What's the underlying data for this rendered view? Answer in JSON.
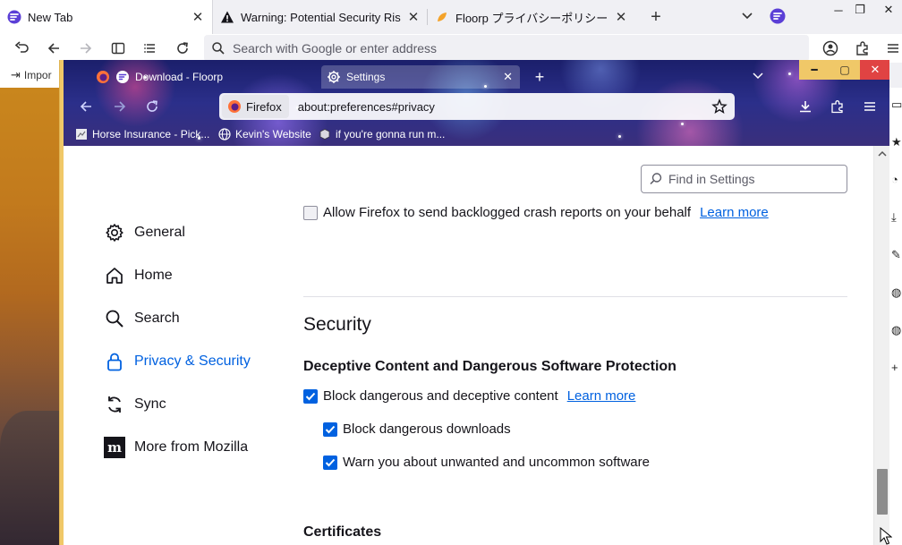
{
  "outer": {
    "tabs": [
      {
        "label": "New Tab",
        "icon": "floorp-icon"
      },
      {
        "label": "Warning: Potential Security Risk Ah",
        "icon": "warning-icon"
      },
      {
        "label": "Floorp プライバシーポリシー / Ab",
        "icon": "floorp-privacy-icon"
      }
    ],
    "url_placeholder": "Search with Google or enter address",
    "bookmark": "Impor"
  },
  "inner": {
    "tabs": [
      {
        "label": "Download - Floorp",
        "icon": "floorp-icon"
      },
      {
        "label": "Settings",
        "icon": "gear-icon"
      }
    ],
    "identity_label": "Firefox",
    "address": "about:preferences#privacy",
    "bookmarks": [
      {
        "label": "Horse Insurance - Pick...",
        "icon": "page-icon"
      },
      {
        "label": "Kevin's Website",
        "icon": "globe-icon"
      },
      {
        "label": "if you're gonna run m...",
        "icon": "page-icon"
      }
    ]
  },
  "settings": {
    "find_placeholder": "Find in Settings",
    "categories": [
      {
        "label": "General",
        "icon": "gear-icon"
      },
      {
        "label": "Home",
        "icon": "home-icon"
      },
      {
        "label": "Search",
        "icon": "search-icon"
      },
      {
        "label": "Privacy & Security",
        "icon": "lock-icon",
        "selected": true
      },
      {
        "label": "Sync",
        "icon": "sync-icon"
      },
      {
        "label": "More from Mozilla",
        "icon": "mozilla-icon"
      }
    ],
    "crash_reports": {
      "label": "Allow Firefox to send backlogged crash reports on your behalf",
      "link": "Learn more",
      "checked": false
    },
    "security_heading": "Security",
    "deceptive_heading": "Deceptive Content and Dangerous Software Protection",
    "block_deceptive": {
      "label": "Block dangerous and deceptive content",
      "link": "Learn more",
      "checked": true
    },
    "block_downloads": {
      "label": "Block dangerous downloads",
      "checked": true
    },
    "warn_unwanted": {
      "label": "Warn you about unwanted and uncommon software",
      "checked": true
    },
    "certificates_heading": "Certificates"
  },
  "colors": {
    "accent": "#0061e0",
    "close_red": "#e04343",
    "frame_gold": "#f0c868"
  }
}
